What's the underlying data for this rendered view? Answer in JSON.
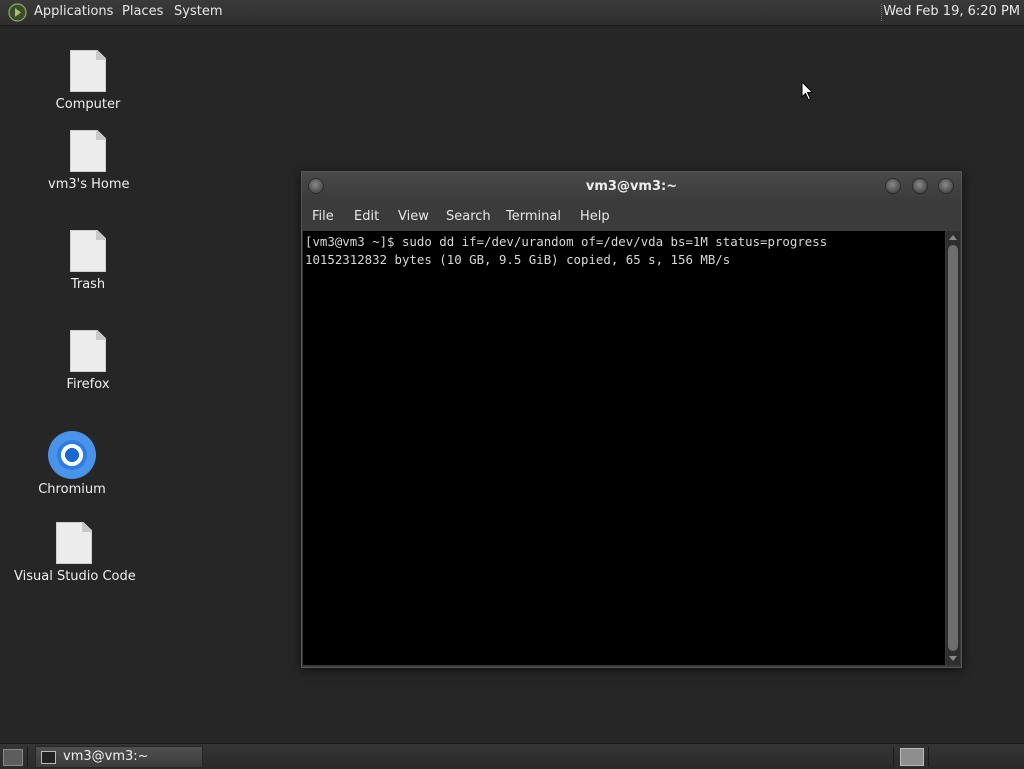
{
  "top_panel": {
    "menu": [
      "Applications",
      "Places",
      "System"
    ],
    "clock": "Wed Feb 19,  6:20 PM"
  },
  "desktop": {
    "icons": [
      {
        "label": "Computer",
        "icon": "file-icon"
      },
      {
        "label": "vm3's Home",
        "icon": "file-icon"
      },
      {
        "label": "Trash",
        "icon": "file-icon"
      },
      {
        "label": "Firefox",
        "icon": "file-icon"
      },
      {
        "label": "Chromium",
        "icon": "chromium-icon"
      },
      {
        "label": "Visual Studio Code",
        "icon": "file-icon"
      }
    ]
  },
  "terminal": {
    "title": "vm3@vm3:~",
    "menu": [
      "File",
      "Edit",
      "View",
      "Search",
      "Terminal",
      "Help"
    ],
    "lines": [
      "[vm3@vm3 ~]$ sudo dd if=/dev/urandom of=/dev/vda bs=1M status=progress",
      "10152312832 bytes (10 GB, 9.5 GiB) copied, 65 s, 156 MB/s"
    ]
  },
  "taskbar": {
    "tasks": [
      {
        "label": "vm3@vm3:~",
        "icon": "terminal-icon"
      }
    ]
  },
  "colors": {
    "desktop_bg": "#262626",
    "terminal_bg": "#000000",
    "terminal_fg": "#d8d8d8",
    "chromium_blue": "#2f7de0"
  }
}
